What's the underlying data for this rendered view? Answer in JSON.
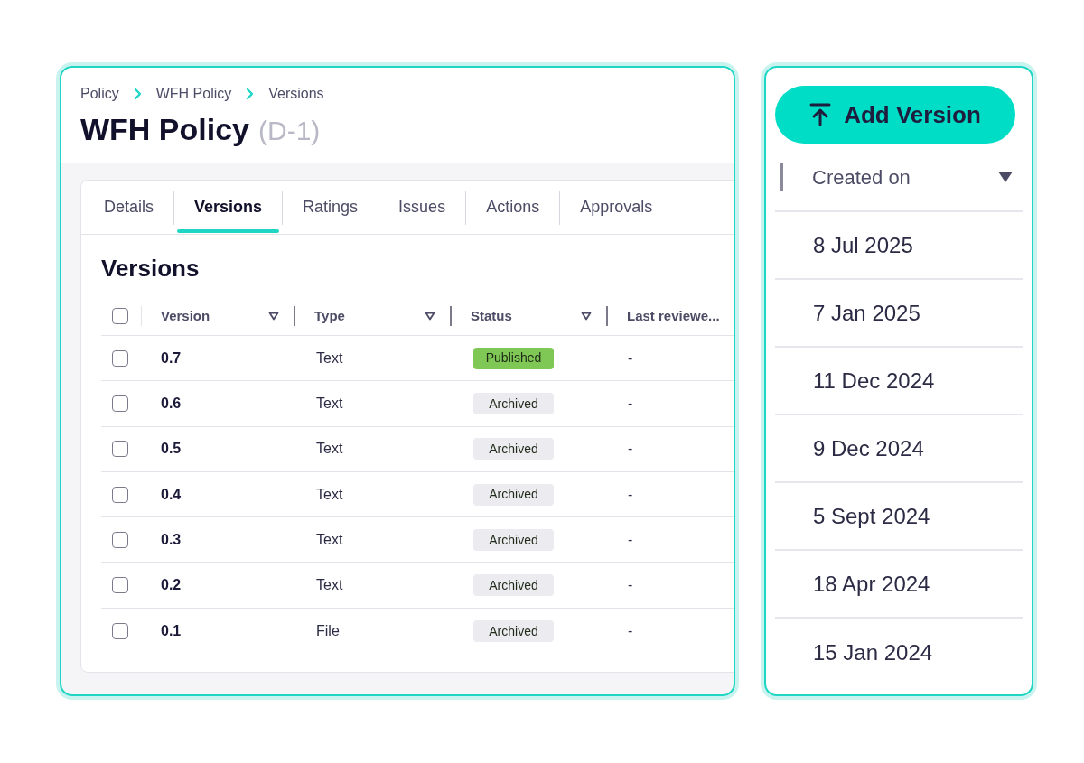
{
  "breadcrumb": [
    "Policy",
    "WFH Policy",
    "Versions"
  ],
  "title": "WFH Policy",
  "code": "(D-1)",
  "tabs": [
    {
      "label": "Details",
      "selected": false
    },
    {
      "label": "Versions",
      "selected": true
    },
    {
      "label": "Ratings",
      "selected": false
    },
    {
      "label": "Issues",
      "selected": false
    },
    {
      "label": "Actions",
      "selected": false
    },
    {
      "label": "Approvals",
      "selected": false
    }
  ],
  "section_title": "Versions",
  "table": {
    "select_all_checked": false,
    "columns": [
      "Version",
      "Type",
      "Status",
      "Last reviewe..."
    ],
    "rows": [
      {
        "checked": false,
        "version": "0.7",
        "type": "Text",
        "status": "Published",
        "color": "#7fc856",
        "last_reviewed": "-"
      },
      {
        "checked": false,
        "version": "0.6",
        "type": "Text",
        "status": "Archived",
        "color": "#ebebf0",
        "last_reviewed": "-"
      },
      {
        "checked": false,
        "version": "0.5",
        "type": "Text",
        "status": "Archived",
        "color": "#ebebf0",
        "last_reviewed": "-"
      },
      {
        "checked": false,
        "version": "0.4",
        "type": "Text",
        "status": "Archived",
        "color": "#ebebf0",
        "last_reviewed": "-"
      },
      {
        "checked": false,
        "version": "0.3",
        "type": "Text",
        "status": "Archived",
        "color": "#ebebf0",
        "last_reviewed": "-"
      },
      {
        "checked": false,
        "version": "0.2",
        "type": "Text",
        "status": "Archived",
        "color": "#ebebf0",
        "last_reviewed": "-"
      },
      {
        "checked": false,
        "version": "0.1",
        "type": "File",
        "status": "Archived",
        "color": "#ebebf0",
        "last_reviewed": "-"
      }
    ]
  },
  "side_panel": {
    "button": "Add Version",
    "column": "Created on",
    "dates": [
      "8 Jul 2025",
      "7 Jan 2025",
      "11 Dec 2024",
      "9 Dec 2024",
      "5 Sept 2024",
      "18 Apr 2024",
      "15 Jan 2024"
    ]
  }
}
